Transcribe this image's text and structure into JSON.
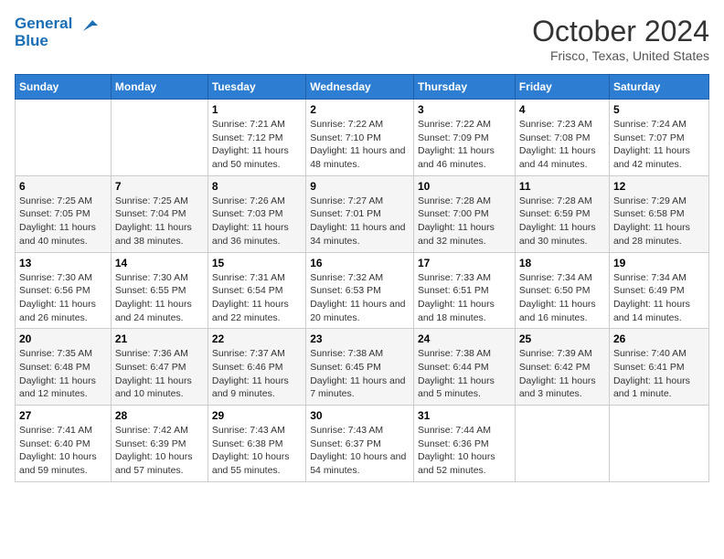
{
  "header": {
    "logo_line1": "General",
    "logo_line2": "Blue",
    "month": "October 2024",
    "location": "Frisco, Texas, United States"
  },
  "weekdays": [
    "Sunday",
    "Monday",
    "Tuesday",
    "Wednesday",
    "Thursday",
    "Friday",
    "Saturday"
  ],
  "weeks": [
    [
      {
        "day": "",
        "sunrise": "",
        "sunset": "",
        "daylight": ""
      },
      {
        "day": "",
        "sunrise": "",
        "sunset": "",
        "daylight": ""
      },
      {
        "day": "1",
        "sunrise": "Sunrise: 7:21 AM",
        "sunset": "Sunset: 7:12 PM",
        "daylight": "Daylight: 11 hours and 50 minutes."
      },
      {
        "day": "2",
        "sunrise": "Sunrise: 7:22 AM",
        "sunset": "Sunset: 7:10 PM",
        "daylight": "Daylight: 11 hours and 48 minutes."
      },
      {
        "day": "3",
        "sunrise": "Sunrise: 7:22 AM",
        "sunset": "Sunset: 7:09 PM",
        "daylight": "Daylight: 11 hours and 46 minutes."
      },
      {
        "day": "4",
        "sunrise": "Sunrise: 7:23 AM",
        "sunset": "Sunset: 7:08 PM",
        "daylight": "Daylight: 11 hours and 44 minutes."
      },
      {
        "day": "5",
        "sunrise": "Sunrise: 7:24 AM",
        "sunset": "Sunset: 7:07 PM",
        "daylight": "Daylight: 11 hours and 42 minutes."
      }
    ],
    [
      {
        "day": "6",
        "sunrise": "Sunrise: 7:25 AM",
        "sunset": "Sunset: 7:05 PM",
        "daylight": "Daylight: 11 hours and 40 minutes."
      },
      {
        "day": "7",
        "sunrise": "Sunrise: 7:25 AM",
        "sunset": "Sunset: 7:04 PM",
        "daylight": "Daylight: 11 hours and 38 minutes."
      },
      {
        "day": "8",
        "sunrise": "Sunrise: 7:26 AM",
        "sunset": "Sunset: 7:03 PM",
        "daylight": "Daylight: 11 hours and 36 minutes."
      },
      {
        "day": "9",
        "sunrise": "Sunrise: 7:27 AM",
        "sunset": "Sunset: 7:01 PM",
        "daylight": "Daylight: 11 hours and 34 minutes."
      },
      {
        "day": "10",
        "sunrise": "Sunrise: 7:28 AM",
        "sunset": "Sunset: 7:00 PM",
        "daylight": "Daylight: 11 hours and 32 minutes."
      },
      {
        "day": "11",
        "sunrise": "Sunrise: 7:28 AM",
        "sunset": "Sunset: 6:59 PM",
        "daylight": "Daylight: 11 hours and 30 minutes."
      },
      {
        "day": "12",
        "sunrise": "Sunrise: 7:29 AM",
        "sunset": "Sunset: 6:58 PM",
        "daylight": "Daylight: 11 hours and 28 minutes."
      }
    ],
    [
      {
        "day": "13",
        "sunrise": "Sunrise: 7:30 AM",
        "sunset": "Sunset: 6:56 PM",
        "daylight": "Daylight: 11 hours and 26 minutes."
      },
      {
        "day": "14",
        "sunrise": "Sunrise: 7:30 AM",
        "sunset": "Sunset: 6:55 PM",
        "daylight": "Daylight: 11 hours and 24 minutes."
      },
      {
        "day": "15",
        "sunrise": "Sunrise: 7:31 AM",
        "sunset": "Sunset: 6:54 PM",
        "daylight": "Daylight: 11 hours and 22 minutes."
      },
      {
        "day": "16",
        "sunrise": "Sunrise: 7:32 AM",
        "sunset": "Sunset: 6:53 PM",
        "daylight": "Daylight: 11 hours and 20 minutes."
      },
      {
        "day": "17",
        "sunrise": "Sunrise: 7:33 AM",
        "sunset": "Sunset: 6:51 PM",
        "daylight": "Daylight: 11 hours and 18 minutes."
      },
      {
        "day": "18",
        "sunrise": "Sunrise: 7:34 AM",
        "sunset": "Sunset: 6:50 PM",
        "daylight": "Daylight: 11 hours and 16 minutes."
      },
      {
        "day": "19",
        "sunrise": "Sunrise: 7:34 AM",
        "sunset": "Sunset: 6:49 PM",
        "daylight": "Daylight: 11 hours and 14 minutes."
      }
    ],
    [
      {
        "day": "20",
        "sunrise": "Sunrise: 7:35 AM",
        "sunset": "Sunset: 6:48 PM",
        "daylight": "Daylight: 11 hours and 12 minutes."
      },
      {
        "day": "21",
        "sunrise": "Sunrise: 7:36 AM",
        "sunset": "Sunset: 6:47 PM",
        "daylight": "Daylight: 11 hours and 10 minutes."
      },
      {
        "day": "22",
        "sunrise": "Sunrise: 7:37 AM",
        "sunset": "Sunset: 6:46 PM",
        "daylight": "Daylight: 11 hours and 9 minutes."
      },
      {
        "day": "23",
        "sunrise": "Sunrise: 7:38 AM",
        "sunset": "Sunset: 6:45 PM",
        "daylight": "Daylight: 11 hours and 7 minutes."
      },
      {
        "day": "24",
        "sunrise": "Sunrise: 7:38 AM",
        "sunset": "Sunset: 6:44 PM",
        "daylight": "Daylight: 11 hours and 5 minutes."
      },
      {
        "day": "25",
        "sunrise": "Sunrise: 7:39 AM",
        "sunset": "Sunset: 6:42 PM",
        "daylight": "Daylight: 11 hours and 3 minutes."
      },
      {
        "day": "26",
        "sunrise": "Sunrise: 7:40 AM",
        "sunset": "Sunset: 6:41 PM",
        "daylight": "Daylight: 11 hours and 1 minute."
      }
    ],
    [
      {
        "day": "27",
        "sunrise": "Sunrise: 7:41 AM",
        "sunset": "Sunset: 6:40 PM",
        "daylight": "Daylight: 10 hours and 59 minutes."
      },
      {
        "day": "28",
        "sunrise": "Sunrise: 7:42 AM",
        "sunset": "Sunset: 6:39 PM",
        "daylight": "Daylight: 10 hours and 57 minutes."
      },
      {
        "day": "29",
        "sunrise": "Sunrise: 7:43 AM",
        "sunset": "Sunset: 6:38 PM",
        "daylight": "Daylight: 10 hours and 55 minutes."
      },
      {
        "day": "30",
        "sunrise": "Sunrise: 7:43 AM",
        "sunset": "Sunset: 6:37 PM",
        "daylight": "Daylight: 10 hours and 54 minutes."
      },
      {
        "day": "31",
        "sunrise": "Sunrise: 7:44 AM",
        "sunset": "Sunset: 6:36 PM",
        "daylight": "Daylight: 10 hours and 52 minutes."
      },
      {
        "day": "",
        "sunrise": "",
        "sunset": "",
        "daylight": ""
      },
      {
        "day": "",
        "sunrise": "",
        "sunset": "",
        "daylight": ""
      }
    ]
  ]
}
